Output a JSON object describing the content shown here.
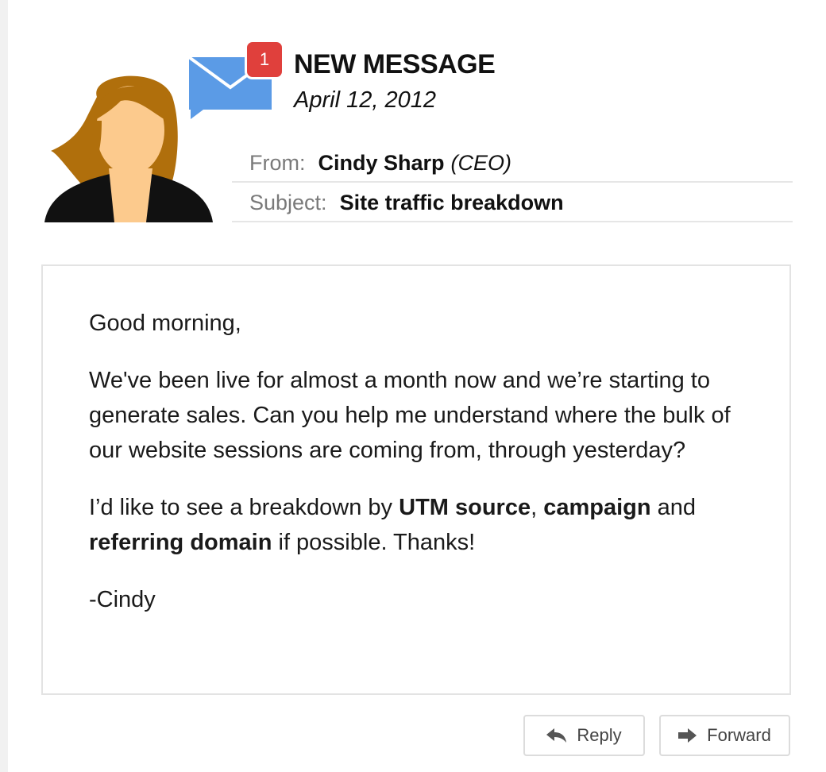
{
  "header": {
    "badge_count": "1",
    "title": "NEW MESSAGE",
    "date": "April 12, 2012"
  },
  "meta": {
    "from_label": "From:",
    "from_name": "Cindy Sharp",
    "from_role": "(CEO)",
    "subject_label": "Subject:",
    "subject_value": "Site traffic breakdown"
  },
  "body": {
    "greeting": "Good morning,",
    "paragraph1": "We've been live for almost a month now and we’re starting to generate sales. Can you help me understand where the bulk of our website sessions are coming from, through yesterday?",
    "p2_part1": "I’d like to see a breakdown by ",
    "p2_bold1": "UTM source",
    "p2_part2": ", ",
    "p2_bold2": "campaign",
    "p2_part3": " and ",
    "p2_bold3": "referring domain",
    "p2_part4": " if possible. Thanks!",
    "signature": "-Cindy"
  },
  "actions": {
    "reply_label": "Reply",
    "forward_label": "Forward"
  },
  "icons": {
    "avatar": "woman-avatar-icon",
    "envelope": "envelope-chat-icon",
    "reply": "reply-arrow-icon",
    "forward": "forward-arrow-icon"
  },
  "colors": {
    "badge": "#e0403c",
    "envelope": "#5b9be6",
    "hair": "#b06f0c",
    "skin": "#fcca8d"
  }
}
